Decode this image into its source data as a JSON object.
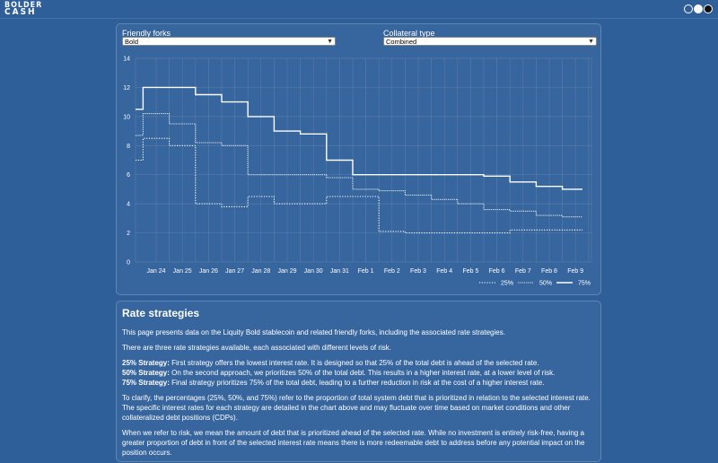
{
  "header": {
    "logo_line1": "BOLDER",
    "logo_line2": "CASH"
  },
  "filters": {
    "forks_label": "Friendly forks",
    "forks_value": "Bold",
    "collateral_label": "Collateral type",
    "collateral_value": "Combined"
  },
  "chart_data": {
    "type": "line",
    "x": [
      "Jan 24",
      "Jan 25",
      "Jan 26",
      "Jan 27",
      "Jan 28",
      "Jan 29",
      "Jan 30",
      "Jan 31",
      "Feb 1",
      "Feb 2",
      "Feb 3",
      "Feb 4",
      "Feb 5",
      "Feb 6",
      "Feb 7",
      "Feb 8",
      "Feb 9"
    ],
    "ylim": [
      0,
      14
    ],
    "yticks": [
      0,
      2,
      4,
      6,
      8,
      10,
      12,
      14
    ],
    "grid": true,
    "legend_position": "bottom-right",
    "series": [
      {
        "name": "25%",
        "style": "dotted",
        "values": [
          8.5,
          8.0,
          4.0,
          3.8,
          4.5,
          4.0,
          4.0,
          4.5,
          4.5,
          2.1,
          2.0,
          2.0,
          2.0,
          2.0,
          2.2,
          2.2,
          2.2
        ]
      },
      {
        "name": "50%",
        "style": "dotted",
        "values": [
          10.2,
          9.5,
          8.2,
          8.0,
          6.0,
          6.0,
          6.0,
          5.8,
          5.0,
          4.9,
          4.6,
          4.3,
          4.0,
          3.6,
          3.5,
          3.2,
          3.1
        ]
      },
      {
        "name": "75%",
        "style": "solid",
        "values": [
          12.0,
          12.0,
          11.5,
          11.0,
          10.0,
          9.0,
          8.8,
          7.0,
          6.0,
          6.0,
          6.0,
          6.0,
          6.0,
          5.9,
          5.5,
          5.2,
          5.0
        ]
      }
    ]
  },
  "strategies": {
    "title": "Rate strategies",
    "intro": "This page presents data on the Liquity Bold stablecoin and related friendly forks, including the associated rate strategies.",
    "count_text": "There are three rate strategies available, each associated with different levels of risk.",
    "s25_label": "25% Strategy:",
    "s25_text": " First strategy offers the lowest interest rate. It is designed so that 25% of the total debt is ahead of the selected rate.",
    "s50_label": "50% Strategy:",
    "s50_text": " On the second approach, we prioritizes 50% of the total debt. This results in a higher interest rate, at a lower level of risk.",
    "s75_label": "75% Strategy:",
    "s75_text": " Final strategy prioritizes 75% of the total debt, leading to a further reduction in risk at the cost of a higher interest rate.",
    "clarify": "To clarify, the percentages (25%, 50%, and 75%) refer to the proportion of total system debt that is prioritized in relation to the selected interest rate. The specific interest rates for each strategy are detailed in the chart above and may fluctuate over time based on market conditions and other collateralized debt positions (CDPs).",
    "risk": "When we refer to risk, we mean the amount of debt that is prioritized ahead of the selected rate. While no investment is entirely risk-free, having a greater proportion of debt in front of the selected interest rate means there is more redeemable debt to address before any potential impact on the position occurs."
  },
  "colors": {
    "background": "#2f5f99",
    "line": "#ffffff"
  }
}
